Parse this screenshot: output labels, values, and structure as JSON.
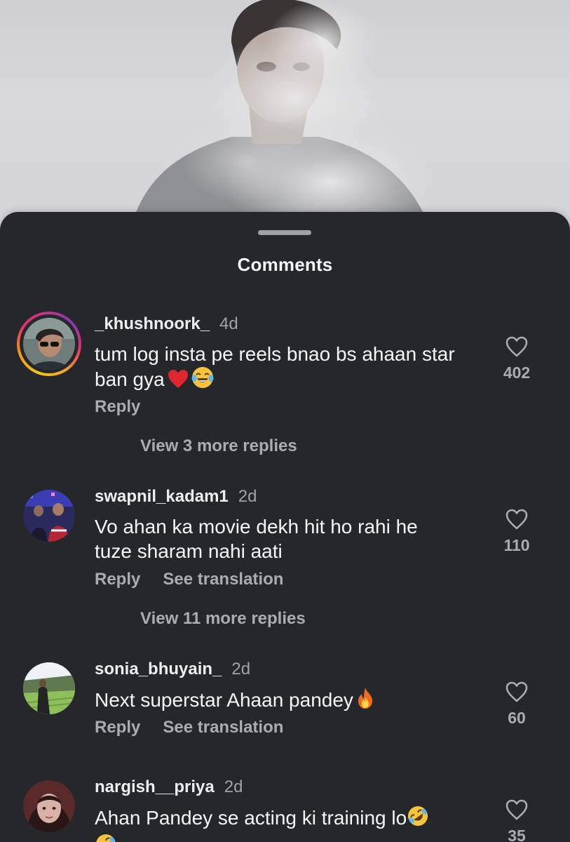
{
  "sheet": {
    "title": "Comments"
  },
  "comments": [
    {
      "username": "_khushnoork_",
      "time": "4d",
      "text_line1": "tum log insta pe reels bnao bs ahaan star",
      "text_line2": "ban gya",
      "emojis": [
        "red-heart",
        "tears-of-joy"
      ],
      "reply_label": "Reply",
      "likes": "402",
      "view_replies": "View 3 more replies",
      "has_story_ring": true
    },
    {
      "username": "swapnil_kadam1",
      "time": "2d",
      "text_line1": "Vo ahan ka movie dekh hit ho rahi he",
      "text_line2": "tuze sharam nahi aati",
      "reply_label": "Reply",
      "translate_label": "See translation",
      "likes": "110",
      "view_replies": "View 11 more replies"
    },
    {
      "username": "sonia_bhuyain_",
      "time": "2d",
      "text_line1": "Next superstar Ahaan pandey",
      "emojis": [
        "fire"
      ],
      "reply_label": "Reply",
      "translate_label": "See translation",
      "likes": "60"
    },
    {
      "username": "nargish__priya",
      "time": "2d",
      "text_line1": "Ahan Pandey se acting  ki training lo",
      "emojis": [
        "rolling-on-floor-laughing"
      ],
      "likes": "35"
    }
  ],
  "colors": {
    "sheet_bg": "#25272b",
    "text_primary": "#f5f6f8",
    "text_secondary": "#a9adb3"
  }
}
